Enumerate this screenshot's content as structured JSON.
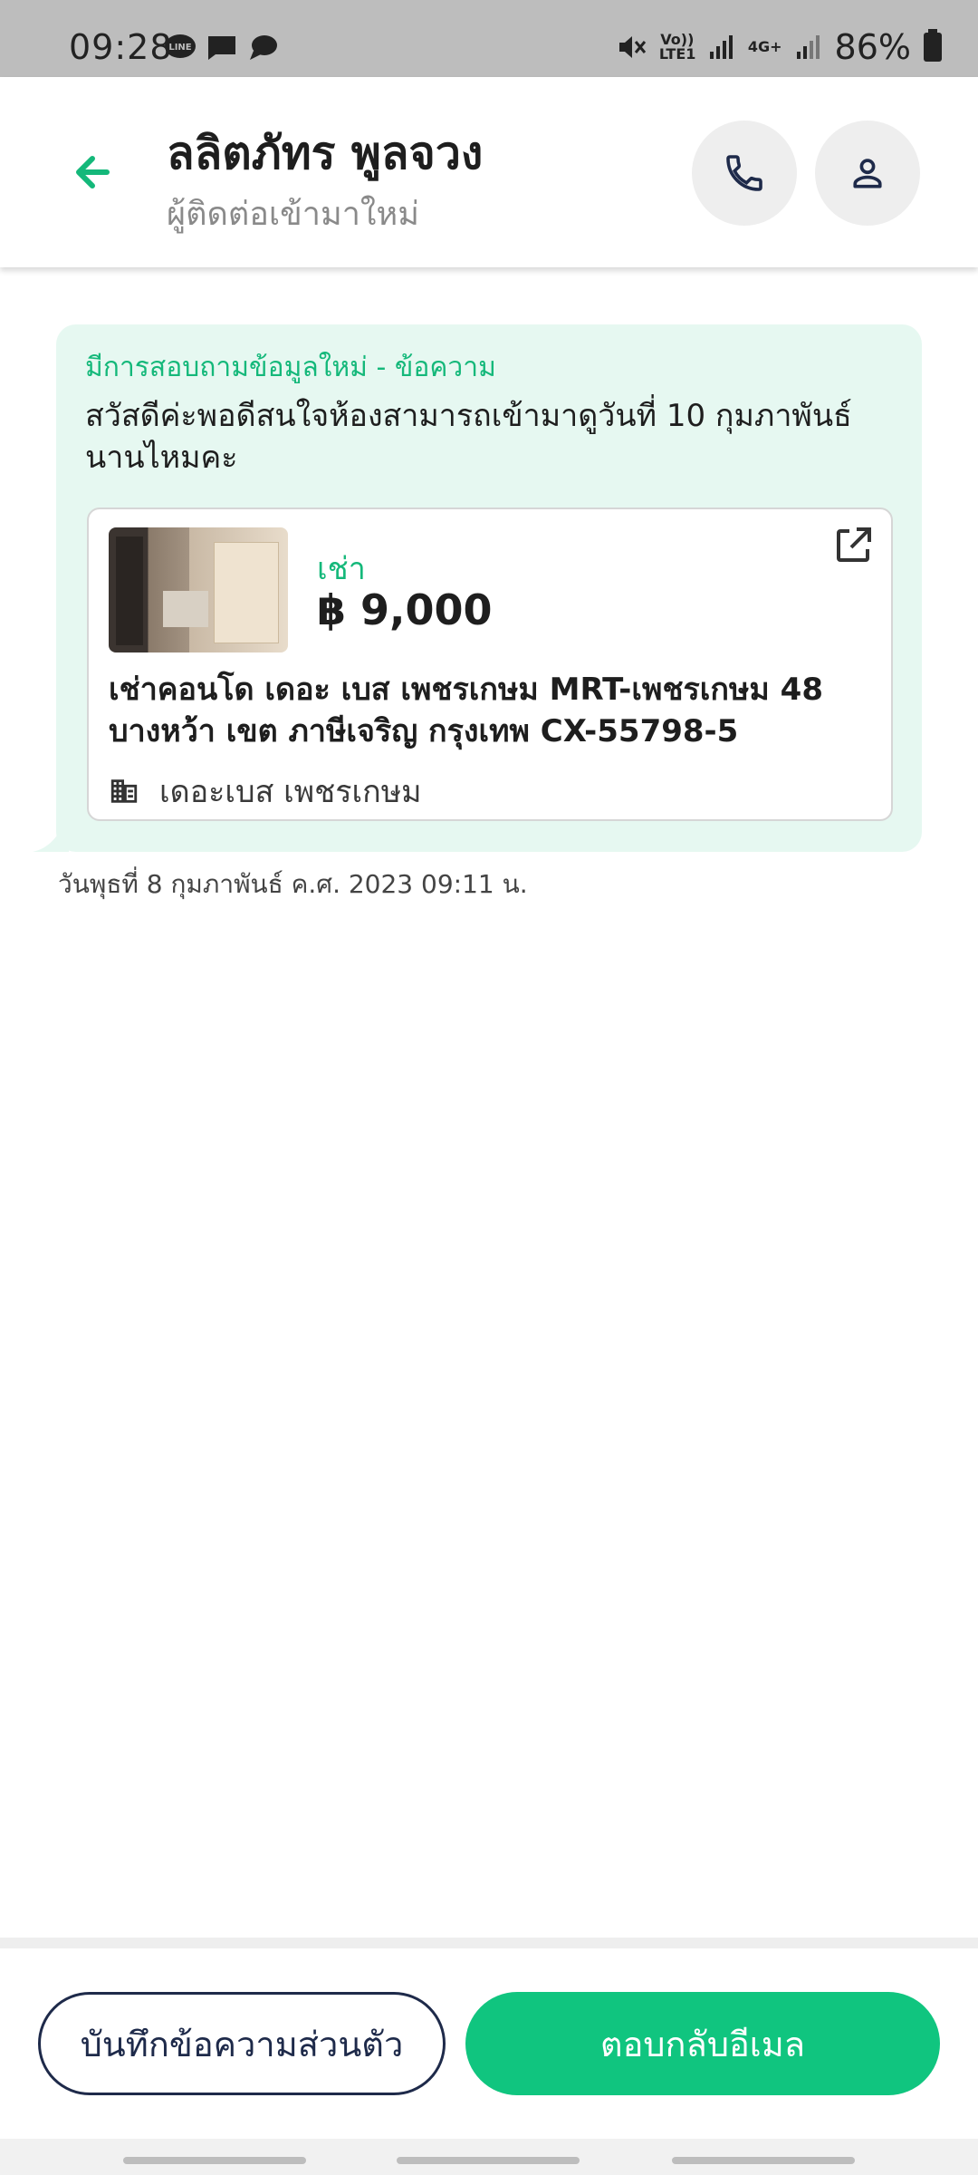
{
  "status_bar": {
    "time": "09:28",
    "volte_label": "Vo)) LTE1",
    "network_label": "4G+",
    "battery_percent": "86%"
  },
  "header": {
    "contact_name": "ลลิตภัทร พูลจวง",
    "contact_status": "ผู้ติดต่อเข้ามาใหม่",
    "back_icon": "arrow-left-icon",
    "call_icon": "phone-icon",
    "profile_icon": "person-icon"
  },
  "message": {
    "label": "มีการสอบถามข้อมูลใหม่ - ข้อความ",
    "text": "สวัสดีค่ะพอดีสนใจห้องสามารถเข้ามาดูวันที่ 10 กุมภาพันธ์ นานไหมคะ",
    "timestamp": "วันพุธที่ 8 กุมภาพันธ์ ค.ศ. 2023 09:11 น.",
    "listing": {
      "type": "เช่า",
      "price": "฿ 9,000",
      "title": "เช่าคอนโด เดอะ เบส เพชรเกษม MRT-เพชรเกษม 48 บางหว้า เขต ภาษีเจริญ กรุงเทพ CX-55798-5",
      "project": "เดอะเบส เพชรเกษม"
    }
  },
  "actions": {
    "note_label": "บันทึกข้อความส่วนตัว",
    "reply_label": "ตอบกลับอีเมล"
  },
  "colors": {
    "accent": "#10c57f",
    "bubble_bg": "#e6f8f1",
    "navy": "#1e2a4a"
  }
}
